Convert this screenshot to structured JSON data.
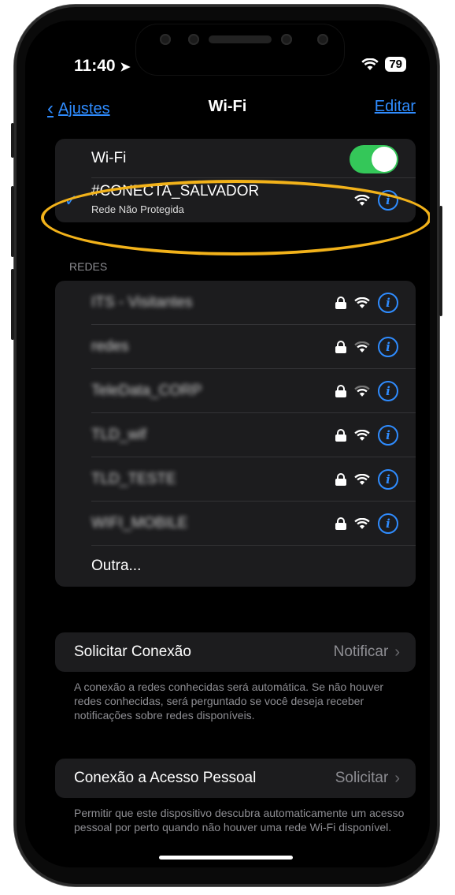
{
  "status": {
    "time": "11:40",
    "battery": "79"
  },
  "nav": {
    "back": "Ajustes",
    "title": "Wi-Fi",
    "edit": "Editar"
  },
  "wifi": {
    "toggle_label": "Wi-Fi",
    "toggle_on": true
  },
  "connected": {
    "ssid": "#CONECTA_SALVADOR",
    "subtitle": "Rede Não Protegida"
  },
  "networks_header": "REDES",
  "networks": [
    {
      "name": "ITS - Visitantes",
      "locked": true
    },
    {
      "name": "redes",
      "locked": true
    },
    {
      "name": "TeleData_CORP",
      "locked": true
    },
    {
      "name": "TLD_wif",
      "locked": true
    },
    {
      "name": "TLD_TESTE",
      "locked": true
    },
    {
      "name": "WIFI_MOBILE",
      "locked": true
    }
  ],
  "other_label": "Outra...",
  "ask_join": {
    "label": "Solicitar Conexão",
    "value": "Notificar",
    "footer": "A conexão a redes conhecidas será automática. Se não houver redes conhecidas, será perguntado se você deseja receber notificações sobre redes disponíveis."
  },
  "hotspot": {
    "label": "Conexão a Acesso Pessoal",
    "value": "Solicitar",
    "footer": "Permitir que este dispositivo descubra automaticamente um acesso pessoal por perto quando não houver uma rede Wi-Fi disponível."
  },
  "colors": {
    "accent": "#2f8cff",
    "toggle": "#34c759",
    "highlight": "#f2b21a"
  }
}
